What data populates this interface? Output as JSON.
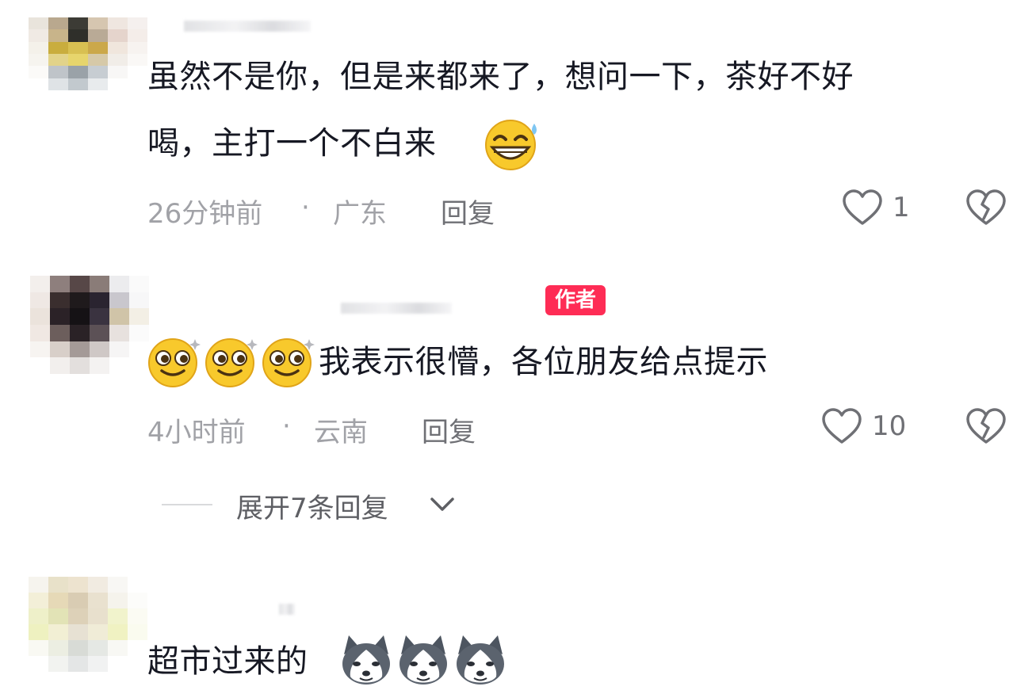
{
  "comments": [
    {
      "text_line1": "虽然不是你，但是来都来了，想问一下，茶好不好",
      "text_line2": "喝，主打一个不白来",
      "emoji": "grinning-sweat-emoji",
      "time": "26分钟前",
      "separator": "·",
      "location": "广东",
      "reply": "回复",
      "likes": "1"
    },
    {
      "badge": "作者",
      "emoji": "sparkle-eyes-emoji",
      "emoji_count": 3,
      "text": "我表示很懵，各位朋友给点提示",
      "time": "4小时前",
      "separator": "·",
      "location": "云南",
      "reply": "回复",
      "likes": "10",
      "expand": "展开7条回复"
    },
    {
      "text": "超市过来的",
      "emoji": "husky-dog-emoji",
      "emoji_count": 3
    }
  ],
  "colors": {
    "text": "#161823",
    "meta": "#a1a2a7",
    "reply": "#6f7075",
    "badge": "#fe2c55"
  }
}
